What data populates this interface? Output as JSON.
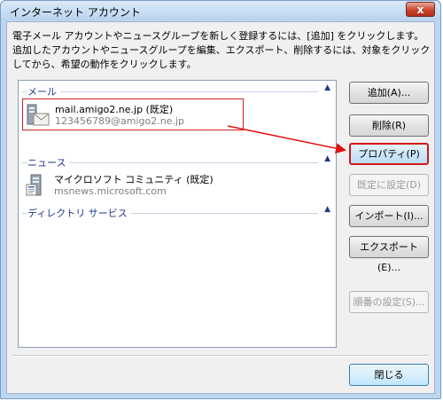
{
  "window": {
    "title": "インターネット アカウント",
    "close_glyph": "x"
  },
  "description": "電子メール アカウントやニュースグループを新しく登録するには、[追加] をクリックします。追加したアカウントやニュースグループを編集、エクスポート、削除するには、対象をクリックしてから、希望の動作をクリックします。",
  "list": {
    "groups": [
      {
        "label": "メール"
      },
      {
        "label": "ニュース"
      },
      {
        "label": "ディレクトリ サービス"
      }
    ],
    "accounts": [
      {
        "name": "mail.amigo2.ne.jp (既定)",
        "sub": "123456789@amigo2.ne.jp",
        "icon": "mail-account-icon",
        "selected": true
      },
      {
        "name": "マイクロソフト コミュニティ (既定)",
        "sub": "msnews.microsoft.com",
        "icon": "news-server-icon",
        "selected": false
      }
    ]
  },
  "buttons": {
    "add": "追加(A)...",
    "delete": "削除(R)",
    "properties": "プロパティ(P)",
    "set_default": "既定に設定(D)",
    "import": "インポート(I)...",
    "export": "エクスポート(E)...",
    "set_order": "順番の設定(S)...",
    "close": "閉じる"
  },
  "colors": {
    "highlight_red": "#d01818",
    "titlebar": "#bcd6ef",
    "group_text": "#1e3a8a"
  }
}
